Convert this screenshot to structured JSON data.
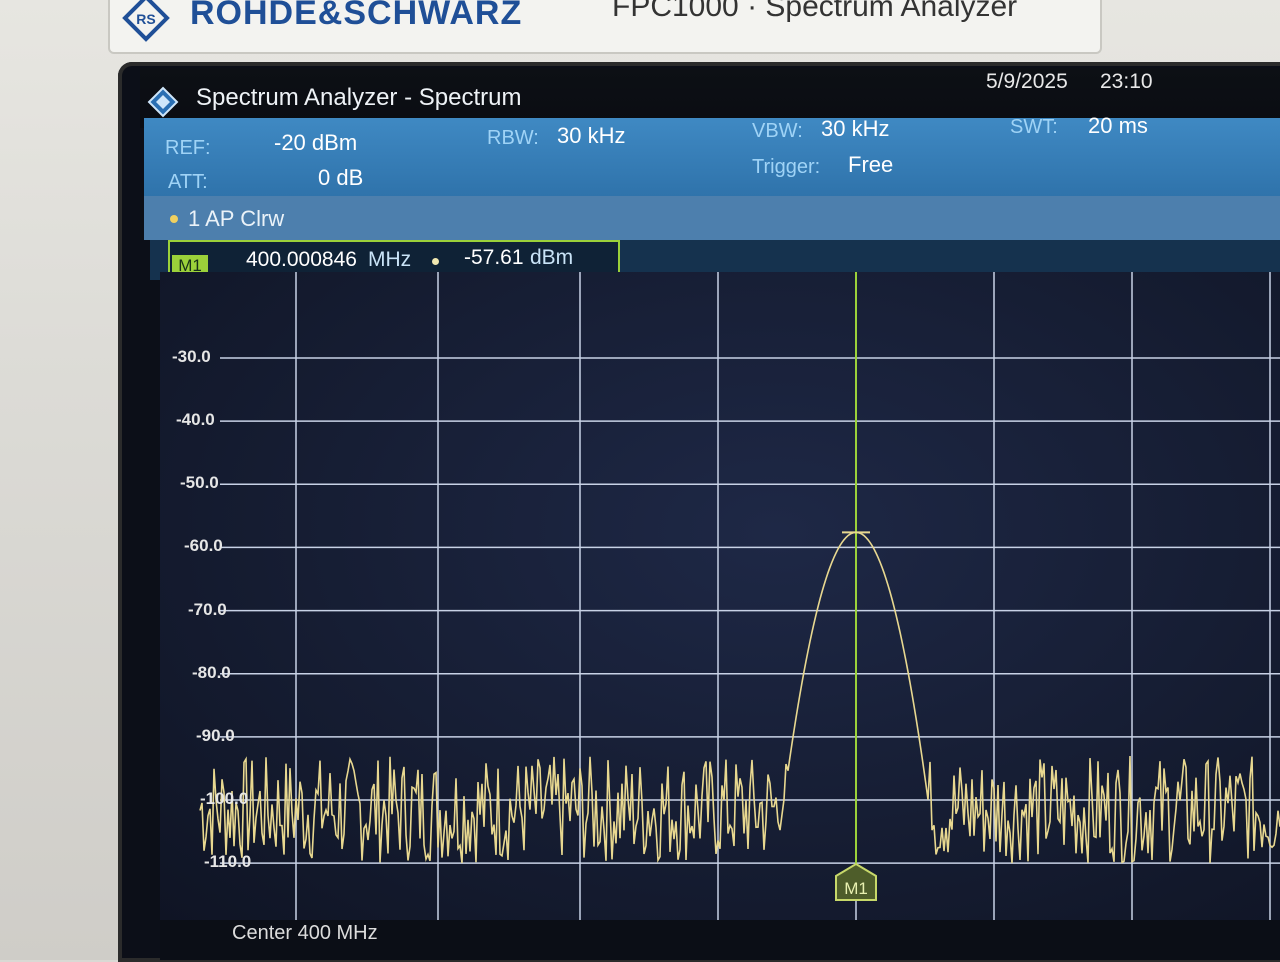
{
  "device": {
    "brand": "ROHDE&SCHWARZ",
    "model": "FPC1000 · Spectrum Analyzer"
  },
  "window": {
    "title": "Spectrum Analyzer - Spectrum",
    "date": "5/9/2025",
    "time": "23:10"
  },
  "params": {
    "ref_label": "REF:",
    "ref_value": "-20 dBm",
    "att_label": "ATT:",
    "att_value": "0 dB",
    "rbw_label": "RBW:",
    "rbw_value": "30 kHz",
    "vbw_label": "VBW:",
    "vbw_value": "30 kHz",
    "trigger_label": "Trigger:",
    "trigger_value": "Free",
    "swt_label": "SWT:",
    "swt_value": "20 ms"
  },
  "trace": {
    "label": "1 AP Clrw",
    "color": "#e8d890"
  },
  "marker": {
    "tag": "M1",
    "frequency": "400.000846",
    "frequency_unit": "MHz",
    "level": "-57.61",
    "level_unit": "dBm",
    "color": "#9bd13a"
  },
  "footer": {
    "center": "Center 400 MHz"
  },
  "chart_data": {
    "type": "line",
    "y_tick_labels": [
      "-30.0",
      "-40.0",
      "-50.0",
      "-60.0",
      "-70.0",
      "-80.0",
      "-90.0",
      "-100.0",
      "-110.0"
    ],
    "ylim": [
      -118,
      -20
    ],
    "grid": true,
    "center_frequency_mhz": 400,
    "marker_frequency_mhz": 400.000846,
    "peak_level_dbm": -57.61,
    "noise_floor_dbm": [
      -110,
      -93
    ]
  }
}
